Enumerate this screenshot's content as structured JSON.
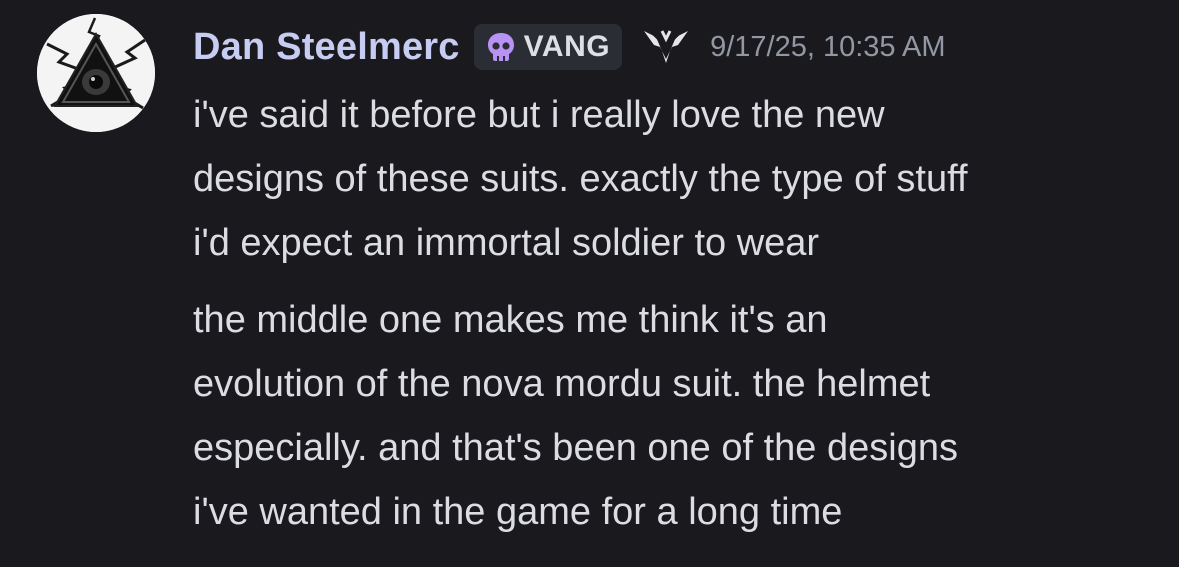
{
  "message": {
    "author": "Dan Steelmerc",
    "tag": {
      "label": "VANG",
      "icon": "skull-icon",
      "color": "#b992f5"
    },
    "role_icon": "winged-emblem-icon",
    "timestamp": "9/17/25, 10:35 AM",
    "avatar_icon": "eye-triangle-icon",
    "paragraphs": [
      {
        "lines": [
          "i've said it before but i really love the new",
          "designs of these suits. exactly the type of stuff",
          "i'd expect an immortal soldier to wear"
        ]
      },
      {
        "lines": [
          "the middle one makes me think it's an",
          "evolution of the nova mordu suit. the helmet",
          "especially. and that's been one of the designs",
          "i've wanted in the game for a long time"
        ]
      }
    ]
  },
  "colors": {
    "background": "#1a1a1e",
    "username": "#c7ccf3",
    "text": "#dcdde3",
    "timestamp": "#9297a3",
    "tag_background": "#2b2d34"
  }
}
